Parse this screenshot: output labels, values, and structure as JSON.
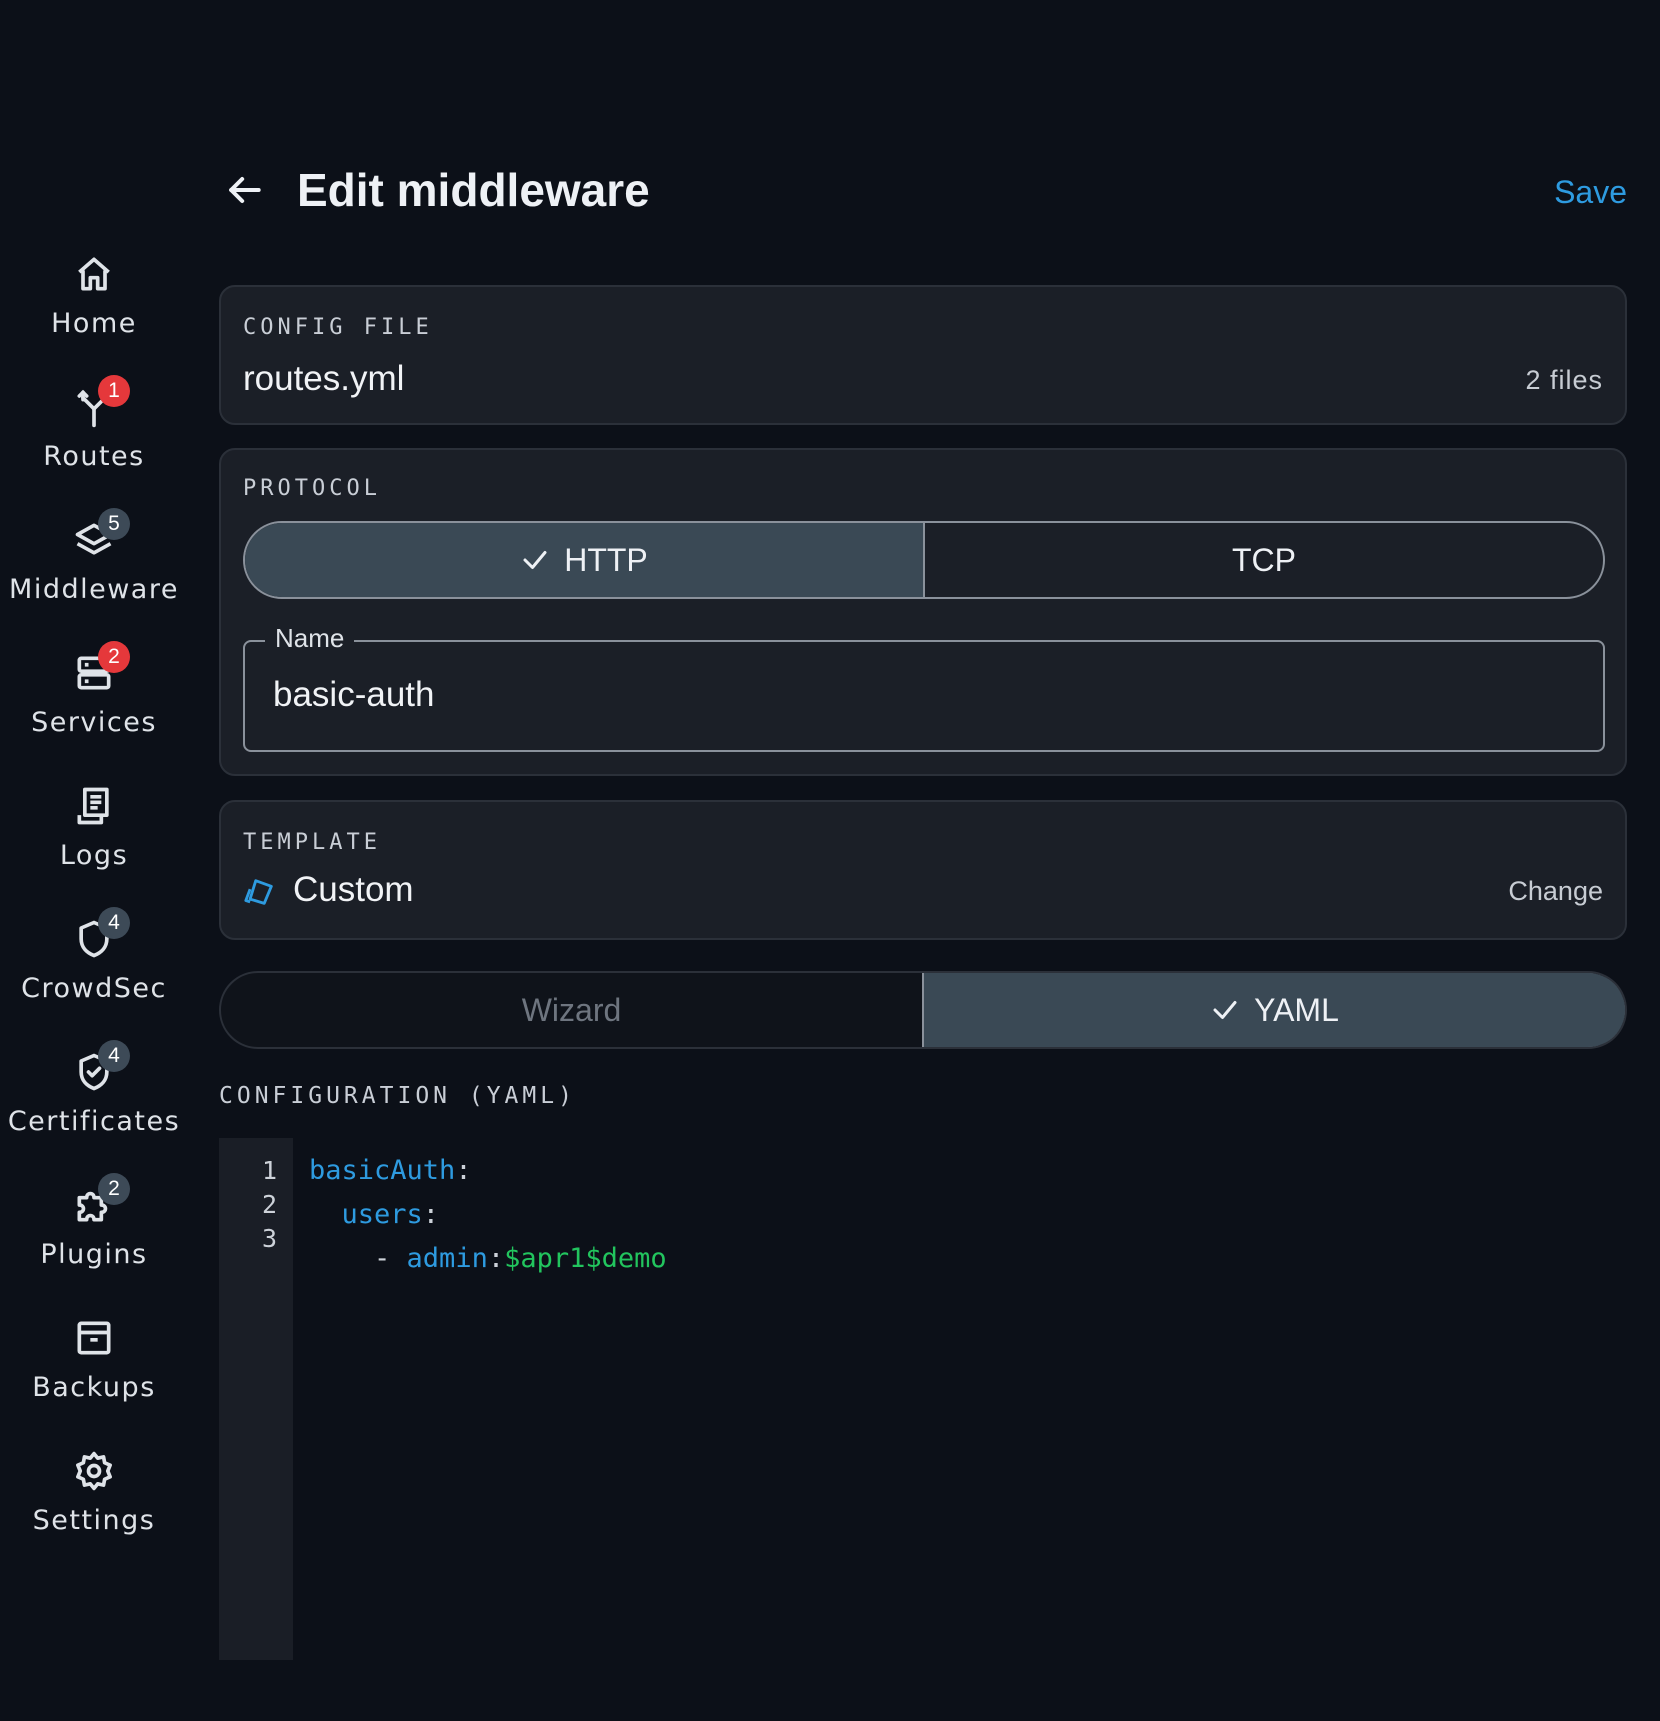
{
  "sidebar": {
    "items": [
      {
        "label": "Home",
        "icon": "home-icon",
        "badge": ""
      },
      {
        "label": "Routes",
        "icon": "routes-icon",
        "badge": "1",
        "badge_color": "#e5383b"
      },
      {
        "label": "Middleware",
        "icon": "layers-icon",
        "badge": "5",
        "badge_color": "#3d4a57"
      },
      {
        "label": "Services",
        "icon": "server-icon",
        "badge": "2",
        "badge_color": "#e5383b"
      },
      {
        "label": "Logs",
        "icon": "logs-icon",
        "badge": ""
      },
      {
        "label": "CrowdSec",
        "icon": "shield-icon",
        "badge": "4",
        "badge_color": "#3d4a57"
      },
      {
        "label": "Certificates",
        "icon": "shield-check-icon",
        "badge": "4",
        "badge_color": "#3d4a57"
      },
      {
        "label": "Plugins",
        "icon": "puzzle-icon",
        "badge": "2",
        "badge_color": "#3d4a57"
      },
      {
        "label": "Backups",
        "icon": "archive-icon",
        "badge": ""
      },
      {
        "label": "Settings",
        "icon": "gear-icon",
        "badge": ""
      }
    ]
  },
  "header": {
    "title": "Edit middleware",
    "save_label": "Save",
    "accent_color": "#2e9be0"
  },
  "config_file": {
    "overline": "CONFIG FILE",
    "value": "routes.yml",
    "meta": "2 files"
  },
  "protocol": {
    "overline": "PROTOCOL",
    "options": [
      {
        "label": "HTTP",
        "selected": true
      },
      {
        "label": "TCP",
        "selected": false
      }
    ]
  },
  "name_field": {
    "label": "Name",
    "value": "basic-auth"
  },
  "template": {
    "overline": "TEMPLATE",
    "value": "Custom",
    "icon": "custom-template-icon",
    "change_label": "Change"
  },
  "mode": {
    "options": [
      {
        "label": "Wizard",
        "selected": false
      },
      {
        "label": "YAML",
        "selected": true
      }
    ]
  },
  "config_yaml": {
    "label": "CONFIGURATION (YAML)",
    "line_numbers": [
      "1",
      "2",
      "3"
    ],
    "lines": [
      {
        "indent": "",
        "key": "basicAuth",
        "sep": ":",
        "dash": "",
        "value": ""
      },
      {
        "indent": "  ",
        "key": "users",
        "sep": ":",
        "dash": "",
        "value": ""
      },
      {
        "indent": "    ",
        "dash": "- ",
        "key": "admin",
        "sep": ":",
        "value": "$apr1$demo"
      }
    ],
    "colors": {
      "key": "#2e9be0",
      "string": "#22c55e"
    }
  }
}
